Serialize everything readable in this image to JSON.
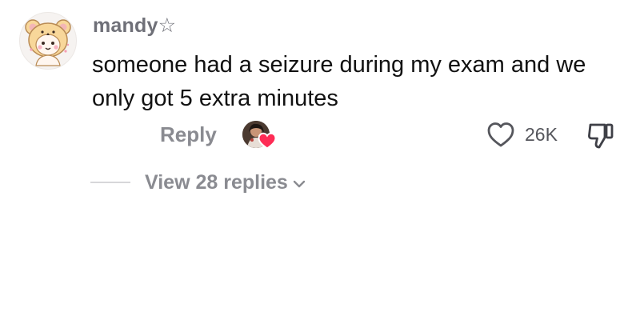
{
  "comment": {
    "username": "mandy☆",
    "text": "someone had a seizure during my exam and we only got 5 extra minutes",
    "reply_label": "Reply",
    "like_count": "26K",
    "view_replies_label": "View 28 replies",
    "liked_by_creator": true
  },
  "icons": {
    "avatar": "bear-hood-avatar",
    "creator": "creator-avatar",
    "creator_heart": "heart-filled-icon",
    "like": "heart-outline-icon",
    "dislike": "thumbs-down-icon",
    "expand": "chevron-down-icon"
  },
  "colors": {
    "username": "#6f7078",
    "text": "#111111",
    "secondary": "#8a8b91",
    "heart_red": "#fe2c55"
  }
}
